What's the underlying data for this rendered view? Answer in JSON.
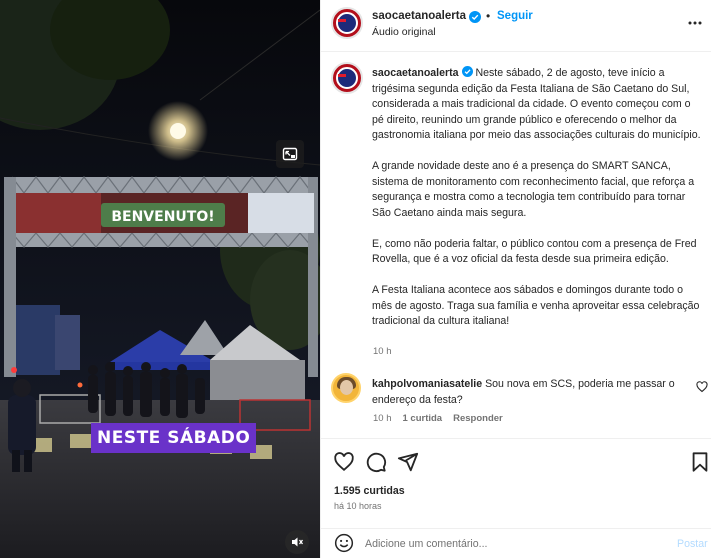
{
  "media": {
    "banner_text": "BENVENUTO!",
    "overlay_caption_highlight": "NESTE",
    "overlay_caption_rest": "SÁBADO",
    "pip_icon": "picture-in-picture-icon",
    "mute_icon": "muted-speaker-icon"
  },
  "header": {
    "username": "saocaetanoalerta",
    "verified_icon": "verified-badge-icon",
    "separator": "•",
    "follow_label": "Seguir",
    "audio_label": "Áudio original",
    "more_icon": "more-horizontal-icon"
  },
  "caption": {
    "username": "saocaetanoalerta",
    "text": "Neste sábado, 2 de agosto, teve início a trigésima segunda edição da Festa Italiana de São Caetano do Sul, considerada a mais tradicional da cidade. O evento começou com o pé direito, reunindo um grande público e oferecendo o melhor da gastronomia italiana por meio das associações culturais do município.\n\nA grande novidade deste ano é a presença do SMART SANCA, sistema de monitoramento com reconhecimento facial, que reforça a segurança e mostra como a tecnologia tem contribuído para tornar São Caetano ainda mais segura.\n\nE, como não poderia faltar, o público contou com a presença de Fred Rovella, que é a voz oficial da festa desde sua primeira edição.\n\nA Festa Italiana acontece aos sábados e domingos durante todo o mês de agosto. Traga sua família e venha aproveitar essa celebração tradicional da cultura italiana!",
    "time": "10 h"
  },
  "comment": {
    "username": "kahpolvomaniasatelie",
    "text": "Sou nova em SCS, poderia me passar o endereço da festa?",
    "time": "10 h",
    "likes": "1 curtida",
    "reply_label": "Responder",
    "heart_icon": "heart-outline-icon"
  },
  "actions": {
    "like_icon": "heart-icon",
    "comment_icon": "comment-bubble-icon",
    "share_icon": "paper-plane-icon",
    "save_icon": "bookmark-icon",
    "likes_count": "1.595 curtidas",
    "posted_ago": "há 10 horas"
  },
  "comment_bar": {
    "emoji_icon": "emoji-smile-icon",
    "placeholder": "Adicione um comentário...",
    "post_label": "Postar"
  },
  "colors": {
    "link_blue": "#0095f6",
    "verified_blue": "#0095f6",
    "overlay_purple": "#6a32c9",
    "brand_red": "#b30f1c"
  }
}
